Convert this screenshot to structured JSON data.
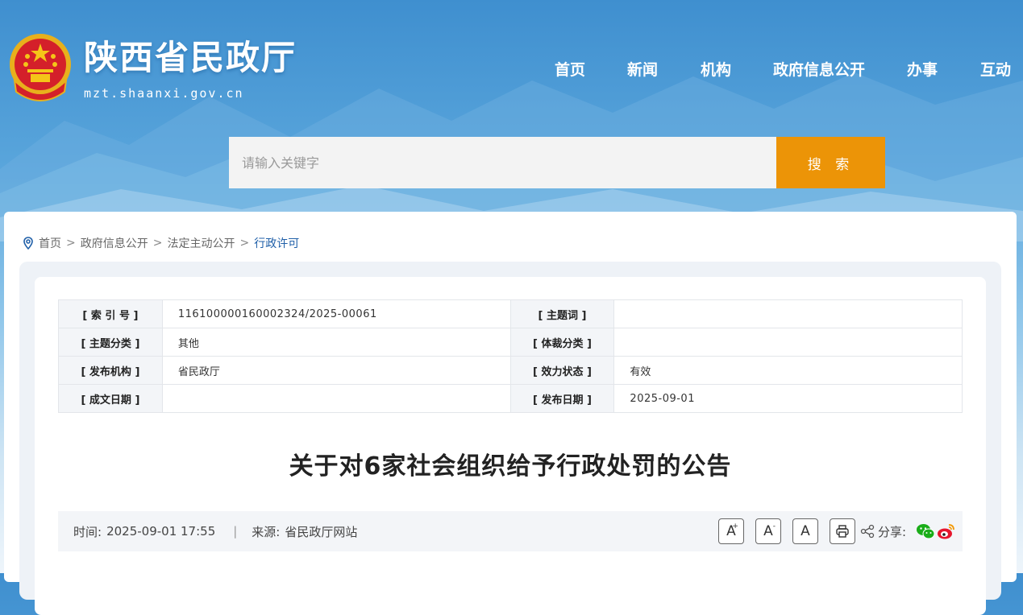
{
  "header": {
    "site_title": "陕西省民政厅",
    "site_domain": "mzt.shaanxi.gov.cn",
    "nav": [
      "首页",
      "新闻",
      "机构",
      "政府信息公开",
      "办事",
      "互动"
    ]
  },
  "search": {
    "placeholder": "请输入关键字",
    "button_label": "搜 索"
  },
  "breadcrumb": {
    "items": [
      "首页",
      "政府信息公开",
      "法定主动公开"
    ],
    "current": "行政许可",
    "separator": ">"
  },
  "meta": {
    "rows": [
      {
        "label1": "[ 索 引 号 ]",
        "value1": "116100000160002324/2025-00061",
        "label2": "[ 主题词 ]",
        "value2": ""
      },
      {
        "label1": "[ 主题分类 ]",
        "value1": "其他",
        "label2": "[ 体裁分类 ]",
        "value2": ""
      },
      {
        "label1": "[ 发布机构 ]",
        "value1": "省民政厅",
        "label2": "[ 效力状态 ]",
        "value2": "有效"
      },
      {
        "label1": "[ 成文日期 ]",
        "value1": "",
        "label2": "[ 发布日期 ]",
        "value2": "2025-09-01"
      }
    ]
  },
  "article": {
    "title": "关于对6家社会组织给予行政处罚的公告",
    "time_label": "时间:",
    "time_value": "2025-09-01 17:55",
    "divider": "|",
    "source_label": "来源:",
    "source_value": "省民政厅网站"
  },
  "tools": {
    "font_large": "A",
    "font_small": "A",
    "font_default": "A",
    "share_label": "分享:"
  },
  "colors": {
    "accent": "#ec9407",
    "link": "#1f5fa8",
    "wechat": "#1aad19",
    "weibo": "#e6162d"
  }
}
